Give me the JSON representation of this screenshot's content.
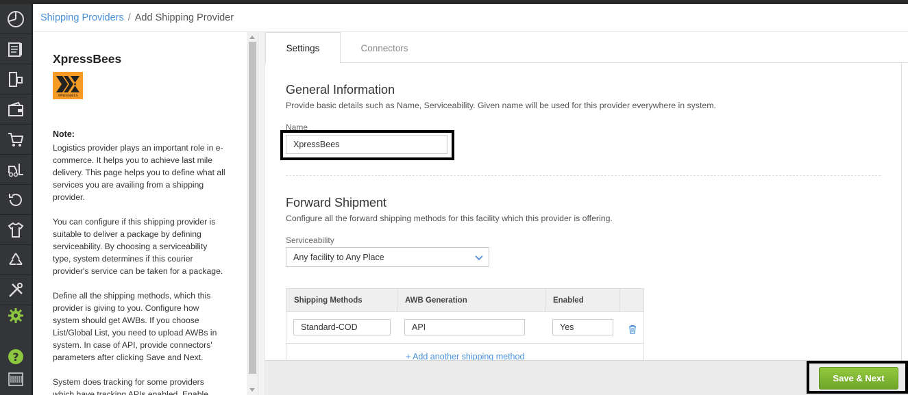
{
  "breadcrumb": {
    "parent": "Shipping Providers",
    "separator": "/",
    "current": "Add Shipping Provider"
  },
  "provider": {
    "name": "XpressBees",
    "logo_text": "XPRESSBEES",
    "logo_color": "#f59a24"
  },
  "note": {
    "title": "Note:",
    "paragraphs": [
      "Logistics provider plays an important role in e-commerce. It helps you to achieve last mile delivery. This page helps you to define what all services you are availing from a shipping provider.",
      "You can configure if this shipping provider is suitable to deliver a package by defining serviceability. By choosing a serviceability type, system determines if this courier provider's service can be taken for a package.",
      "Define all the shipping methods, which this provider is giving to you. Configure how system should get AWBs. If you choose List/Global List, you need to upload AWBs in system. In case of API, provide connectors' parameters after clicking Save and Next.",
      "System does tracking for some providers which have tracking APIs enabled. Enable tracking if"
    ]
  },
  "tabs": [
    {
      "label": "Settings",
      "active": true
    },
    {
      "label": "Connectors",
      "active": false
    }
  ],
  "general": {
    "title": "General Information",
    "description": "Provide basic details such as Name, Serviceability. Given name will be used for this provider everywhere in system.",
    "name_label": "Name",
    "name_value": "XpressBees"
  },
  "forward": {
    "title": "Forward Shipment",
    "description": "Configure all the forward shipping methods for this facility which this provider is offering.",
    "serviceability_label": "Serviceability",
    "serviceability_value": "Any facility to Any Place"
  },
  "shipping_table": {
    "columns": [
      "Shipping Methods",
      "AWB Generation",
      "Enabled"
    ],
    "rows": [
      {
        "method": "Standard-COD",
        "awb": "API",
        "enabled": "Yes"
      }
    ],
    "add_label": "+   Add another shipping method"
  },
  "footer": {
    "save_label": "Save & Next"
  },
  "colors": {
    "accent": "#4a90d9",
    "save_green": "#7cb530",
    "rail": "#333538",
    "gear_green": "#8dc63f"
  },
  "rail_icons": [
    "dashboard-icon",
    "orders-icon",
    "returns-icon",
    "wallet-icon",
    "cart-icon",
    "forklift-icon",
    "refresh-icon",
    "shirt-icon",
    "recycle-icon",
    "tools-icon",
    "settings-icon",
    "help-icon",
    "barcode-icon"
  ]
}
